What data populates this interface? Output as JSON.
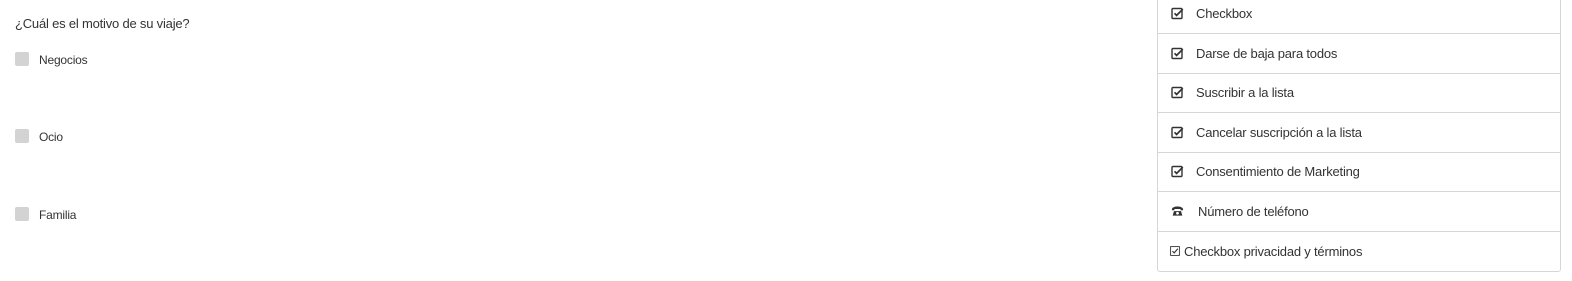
{
  "form": {
    "question": "¿Cuál es el motivo de su viaje?",
    "options": [
      {
        "label": "Negocios",
        "checked": false
      },
      {
        "label": "Ocio",
        "checked": false
      },
      {
        "label": "Familia",
        "checked": false
      }
    ]
  },
  "panel": {
    "items": [
      {
        "label": "Checkbox",
        "icon": "checkbox-check-icon"
      },
      {
        "label": "Darse de baja para todos",
        "icon": "checkbox-check-icon"
      },
      {
        "label": "Suscribir a la lista",
        "icon": "checkbox-check-icon"
      },
      {
        "label": "Cancelar suscripción a la lista",
        "icon": "checkbox-check-icon"
      },
      {
        "label": "Consentimiento de Marketing",
        "icon": "checkbox-check-icon"
      },
      {
        "label": "Número de teléfono",
        "icon": "phone-icon"
      },
      {
        "label": "Checkbox privacidad y términos",
        "icon": "ballot-box-check-icon"
      }
    ]
  },
  "colors": {
    "checkbox_fill": "#d3d3d3",
    "border": "#d6d6d6",
    "text": "#333333"
  }
}
